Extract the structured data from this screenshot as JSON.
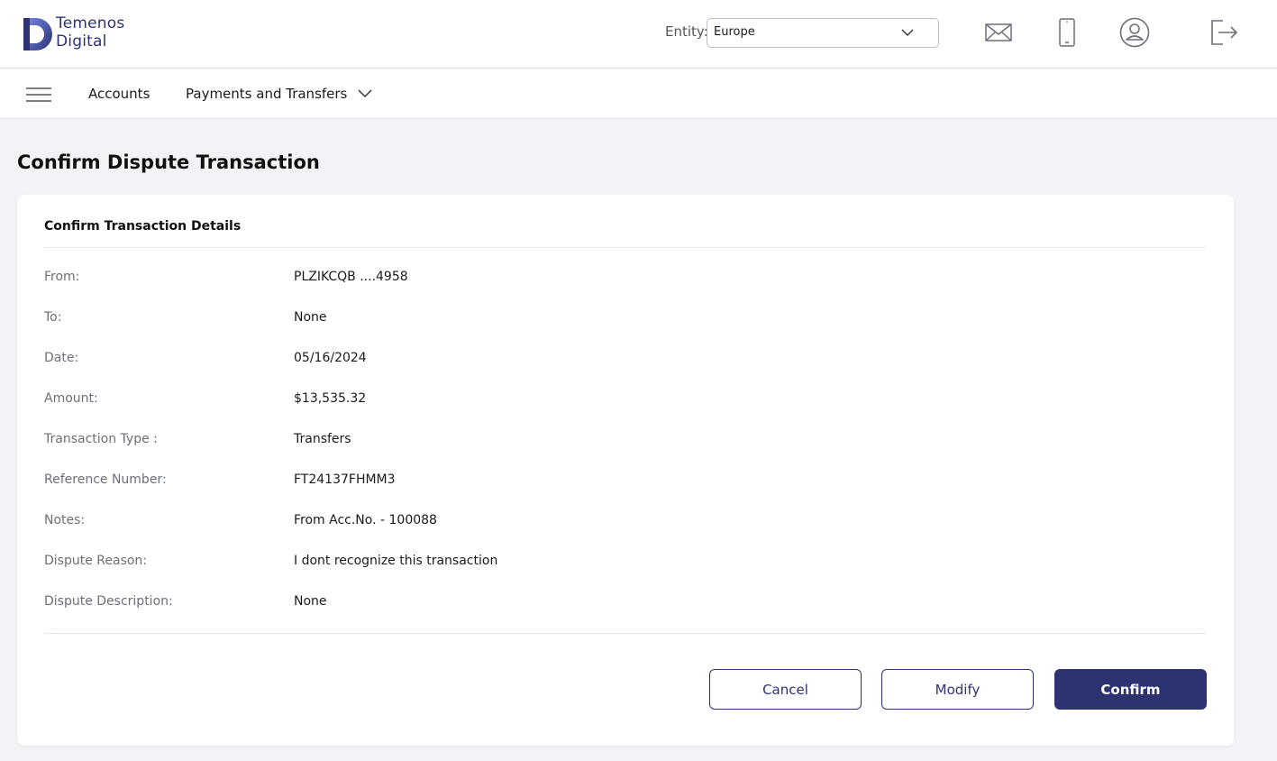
{
  "brand": {
    "line1": "Temenos",
    "line2": "Digital",
    "color": "#2d3370"
  },
  "header": {
    "entity_label": "Entity:",
    "entity_value": "Europe",
    "icons": [
      "mail-icon",
      "mobile-icon",
      "profile-icon",
      "logout-icon"
    ]
  },
  "nav": {
    "items": [
      {
        "label": "Accounts"
      },
      {
        "label": "Payments and Transfers"
      }
    ]
  },
  "page": {
    "title": "Confirm Dispute Transaction"
  },
  "card": {
    "title": "Confirm Transaction Details",
    "rows": [
      {
        "label": "From:",
        "value": "PLZIKCQB ....4958"
      },
      {
        "label": "To:",
        "value": "None"
      },
      {
        "label": "Date:",
        "value": "05/16/2024"
      },
      {
        "label": "Amount:",
        "value": "$13,535.32"
      },
      {
        "label": "Transaction Type :",
        "value": "Transfers"
      },
      {
        "label": "Reference Number:",
        "value": "FT24137FHMM3"
      },
      {
        "label": "Notes:",
        "value": "From Acc.No. - 100088"
      },
      {
        "label": "Dispute Reason:",
        "value": "I dont recognize this transaction"
      },
      {
        "label": "Dispute Description:",
        "value": "None"
      }
    ]
  },
  "actions": {
    "cancel": "Cancel",
    "modify": "Modify",
    "confirm": "Confirm"
  },
  "colors": {
    "primary": "#2d3370",
    "background": "#f1f3f7",
    "card": "#ffffff"
  }
}
